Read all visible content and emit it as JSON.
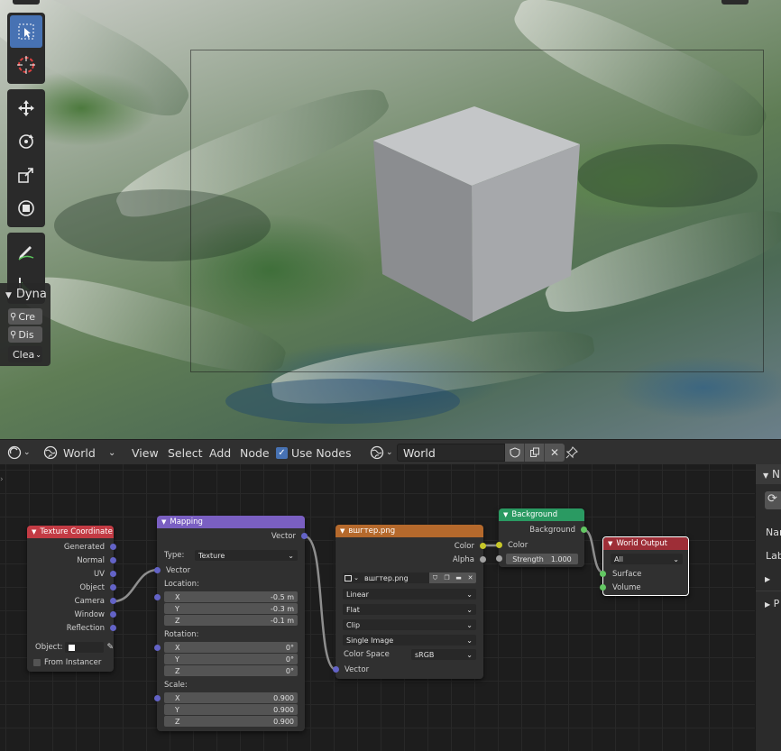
{
  "toolbar": {
    "tools": [
      "select-box",
      "cursor",
      "move",
      "rotate",
      "scale",
      "transform",
      "annotate",
      "measure"
    ],
    "active_tool": "select-box"
  },
  "dyna_panel": {
    "header": "Dyna",
    "btn_create": "Cre",
    "btn_dissolve": "Dis",
    "btn_clear": "Clea"
  },
  "header": {
    "editor_type_icon": "world-shader-icon",
    "shader_type": "World",
    "menu_view": "View",
    "menu_select": "Select",
    "menu_add": "Add",
    "menu_node": "Node",
    "use_nodes_label": "Use Nodes",
    "use_nodes_checked": true,
    "world_name": "World"
  },
  "nodes": {
    "texcoord": {
      "title": "Texture Coordinate",
      "outputs": [
        "Generated",
        "Normal",
        "UV",
        "Object",
        "Camera",
        "Window",
        "Reflection"
      ],
      "object_label": "Object:",
      "from_instancer": "From Instancer",
      "color": "#c33b44"
    },
    "mapping": {
      "title": "Mapping",
      "output": "Vector",
      "type_label": "Type:",
      "type_value": "Texture",
      "input_vector": "Vector",
      "location_label": "Location:",
      "location": {
        "x": "-0.5 m",
        "y": "-0.3 m",
        "z": "-0.1 m"
      },
      "rotation_label": "Rotation:",
      "rotation": {
        "x": "0°",
        "y": "0°",
        "z": "0°"
      },
      "scale_label": "Scale:",
      "scale": {
        "x": "0.900",
        "y": "0.900",
        "z": "0.900"
      },
      "axis_x": "X",
      "axis_y": "Y",
      "axis_z": "Z",
      "color": "#7a5fc2"
    },
    "image": {
      "title": "вшгтер.png",
      "out_color": "Color",
      "out_alpha": "Alpha",
      "image_name": "вшгтер.png",
      "interpolation": "Linear",
      "projection": "Flat",
      "extension": "Clip",
      "source": "Single Image",
      "colorspace_label": "Color Space",
      "colorspace_value": "sRGB",
      "input_vector": "Vector",
      "color": "#b5692c"
    },
    "background": {
      "title": "Background",
      "out": "Background",
      "in_color": "Color",
      "strength_label": "Strength",
      "strength_value": "1.000",
      "color": "#2a9a62"
    },
    "output": {
      "title": "World Output",
      "target": "All",
      "in_surface": "Surface",
      "in_volume": "Volume",
      "color": "#9e2e37"
    }
  },
  "sidepanel": {
    "tab_label": "N",
    "row_name": "Nar",
    "row_label": "Lab",
    "row_p": "P"
  }
}
